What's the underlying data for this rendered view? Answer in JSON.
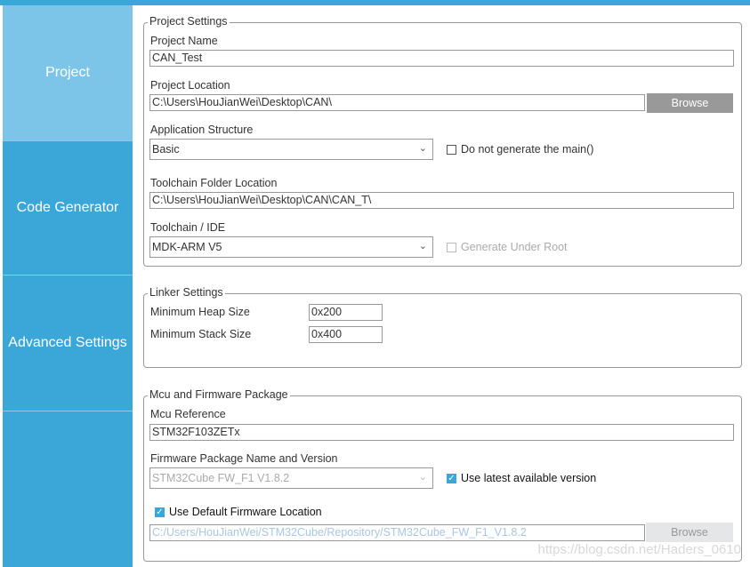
{
  "sidebar": {
    "items": [
      {
        "label": "Project"
      },
      {
        "label": "Code Generator"
      },
      {
        "label": "Advanced Settings"
      }
    ]
  },
  "project_settings": {
    "legend": "Project Settings",
    "project_name_label": "Project Name",
    "project_name": "CAN_Test",
    "project_location_label": "Project Location",
    "project_location": "C:\\Users\\HouJianWei\\Desktop\\CAN\\",
    "browse": "Browse",
    "app_structure_label": "Application Structure",
    "app_structure": "Basic",
    "no_main_label": "Do not generate the main()",
    "toolchain_folder_label": "Toolchain Folder Location",
    "toolchain_folder": "C:\\Users\\HouJianWei\\Desktop\\CAN\\CAN_T\\",
    "toolchain_label": "Toolchain / IDE",
    "toolchain": "MDK-ARM V5",
    "gen_under_root_label": "Generate Under Root"
  },
  "linker": {
    "legend": "Linker Settings",
    "heap_label": "Minimum Heap Size",
    "heap": "0x200",
    "stack_label": "Minimum Stack Size",
    "stack": "0x400"
  },
  "mcu": {
    "legend": "Mcu and Firmware Package",
    "ref_label": "Mcu Reference",
    "ref": "STM32F103ZETx",
    "fw_label": "Firmware Package Name and Version",
    "fw": "STM32Cube FW_F1 V1.8.2",
    "latest_label": "Use latest available version",
    "latest_checked": true,
    "default_loc_label": "Use Default Firmware Location",
    "default_loc_checked": true,
    "fw_path": "C:/Users/HouJianWei/STM32Cube/Repository/STM32Cube_FW_F1_V1.8.2",
    "browse": "Browse"
  },
  "watermark": "https://blog.csdn.net/Haders_0610"
}
